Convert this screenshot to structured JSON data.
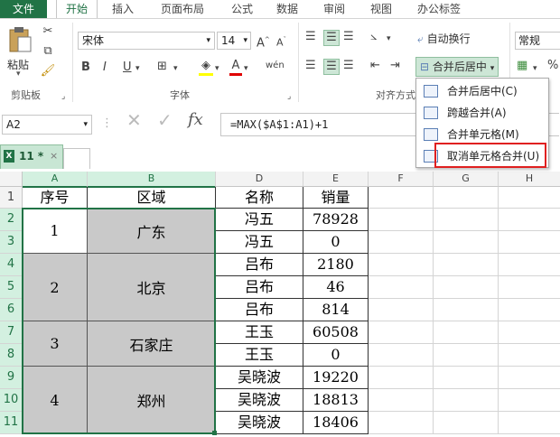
{
  "tabs": {
    "file": "文件",
    "home": "开始",
    "insert": "插入",
    "layout": "页面布局",
    "formula": "公式",
    "data": "数据",
    "review": "审阅",
    "view": "视图",
    "addin": "办公标签"
  },
  "ribbon": {
    "paste_label": "粘贴",
    "clipboard_group": "剪贴板",
    "font_name": "宋体",
    "font_size": "14",
    "font_group": "字体",
    "bold": "B",
    "italic": "I",
    "underline": "U",
    "align_group": "对齐方式",
    "wrap_text": "自动换行",
    "merge_center": "合并后居中",
    "number_format": "常规",
    "percent": "%"
  },
  "merge_menu": {
    "items": [
      {
        "label": "合并后居中(C)"
      },
      {
        "label": "跨越合并(A)"
      },
      {
        "label": "合并单元格(M)"
      },
      {
        "label": "取消单元格合并(U)"
      }
    ]
  },
  "formula_bar": {
    "name_box": "A2",
    "fx": "fx",
    "formula": "=MAX($A$1:A1)+1"
  },
  "sheet_tab": {
    "label": "11 *"
  },
  "grid": {
    "columns": [
      "A",
      "B",
      "D",
      "E",
      "F",
      "G",
      "H"
    ],
    "rows": [
      "1",
      "2",
      "3",
      "4",
      "5",
      "6",
      "7",
      "8",
      "9",
      "10",
      "11"
    ],
    "header_row": {
      "a": "序号",
      "b": "区域",
      "d": "名称",
      "e": "销量"
    },
    "groups": [
      {
        "num": "1",
        "region": "广东"
      },
      {
        "num": "2",
        "region": "北京"
      },
      {
        "num": "3",
        "region": "石家庄"
      },
      {
        "num": "4",
        "region": "郑州"
      }
    ],
    "data_rows": [
      {
        "name": "冯五",
        "sales": "78928"
      },
      {
        "name": "冯五",
        "sales": "0"
      },
      {
        "name": "吕布",
        "sales": "2180"
      },
      {
        "name": "吕布",
        "sales": "46"
      },
      {
        "name": "吕布",
        "sales": "814"
      },
      {
        "name": "王玉",
        "sales": "60508"
      },
      {
        "name": "王玉",
        "sales": "0"
      },
      {
        "name": "吴晓波",
        "sales": "19220"
      },
      {
        "name": "吴晓波",
        "sales": "18813"
      },
      {
        "name": "吴晓波",
        "sales": "18406"
      }
    ]
  },
  "colors": {
    "accent": "#217346",
    "merged_fill": "#c9c9c9",
    "highlight": "#e02020"
  }
}
